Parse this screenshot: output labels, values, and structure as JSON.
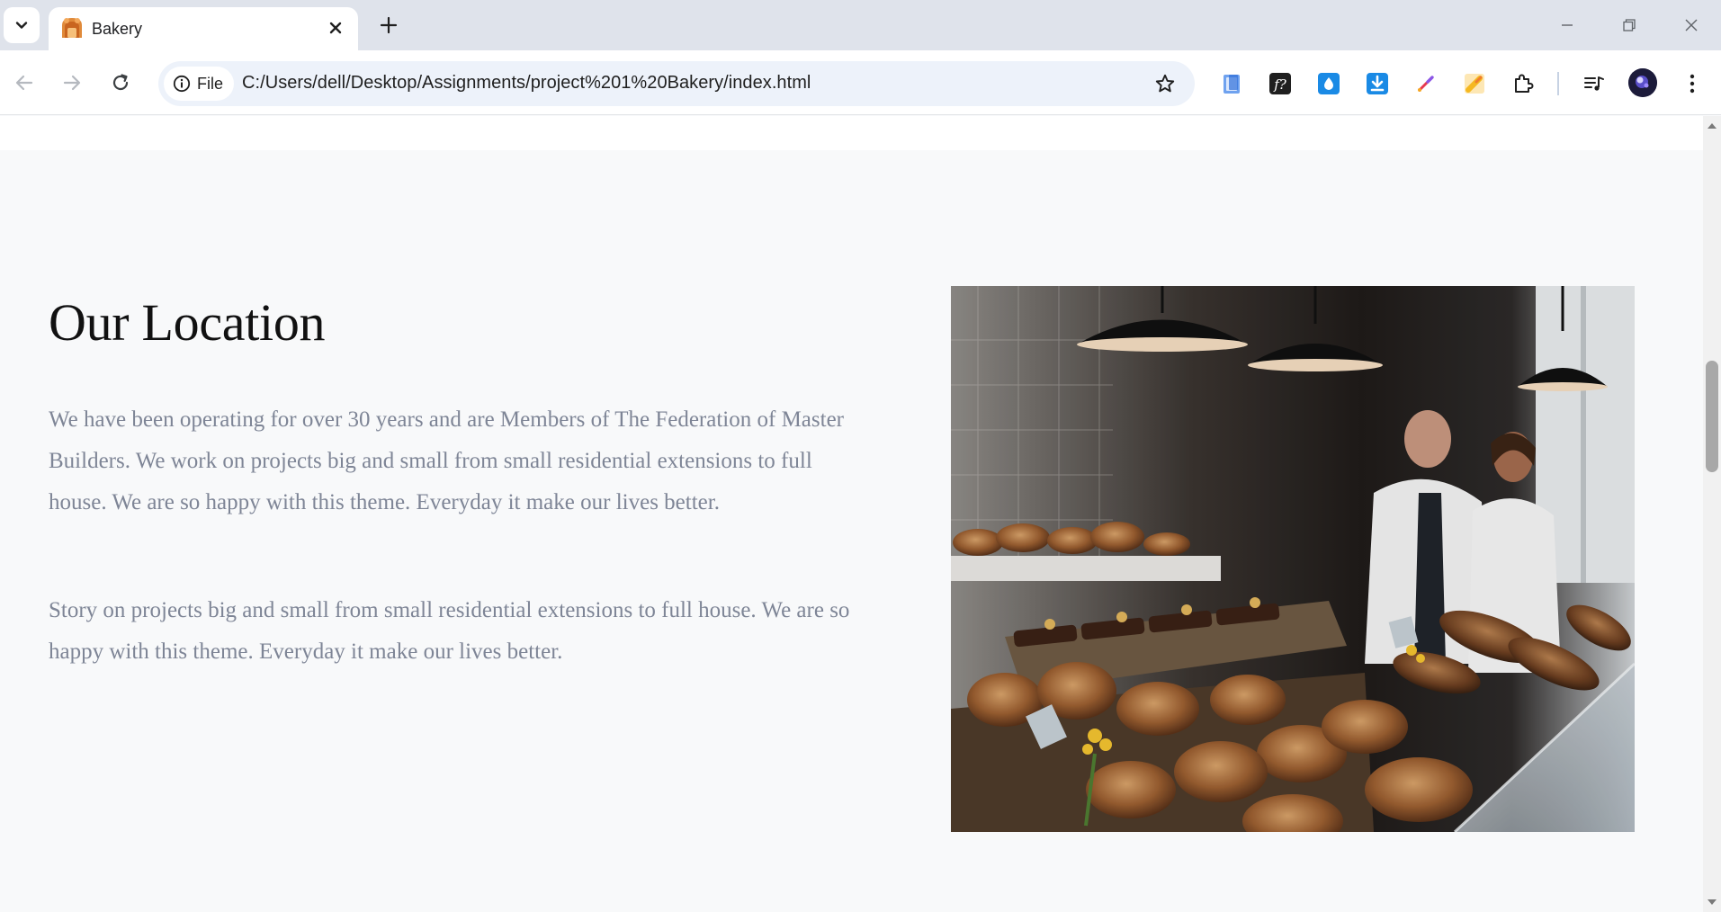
{
  "browser": {
    "tab_title": "Bakery",
    "url": "C:/Users/dell/Desktop/Assignments/project%201%20Bakery/index.html",
    "file_chip_label": "File",
    "accent_color": "#0b57d0"
  },
  "page": {
    "section_heading": "Our Location",
    "paragraph_1": "We have been operating for over 30 years and are Members of The Federation of Master Builders. We work on projects big and small from small residential extensions to full house. We are so happy with this theme. Everyday it make our lives better.",
    "paragraph_2": "Story on projects big and small from small residential extensions to full house. We are so happy with this theme. Everyday it make our lives better.",
    "heading_color": "#111111",
    "text_color": "#7e8596",
    "background_color": "#f8f9fa"
  },
  "icons": {
    "tab_search": "chevron-down-icon",
    "new_tab": "plus-icon",
    "close_tab": "close-icon",
    "back": "arrow-left-icon",
    "forward": "arrow-right-icon",
    "reload": "reload-icon",
    "site_info": "info-icon",
    "bookmark": "star-icon",
    "extensions": "puzzle-icon",
    "media": "media-controls-icon",
    "menu": "kebab-menu-icon"
  }
}
